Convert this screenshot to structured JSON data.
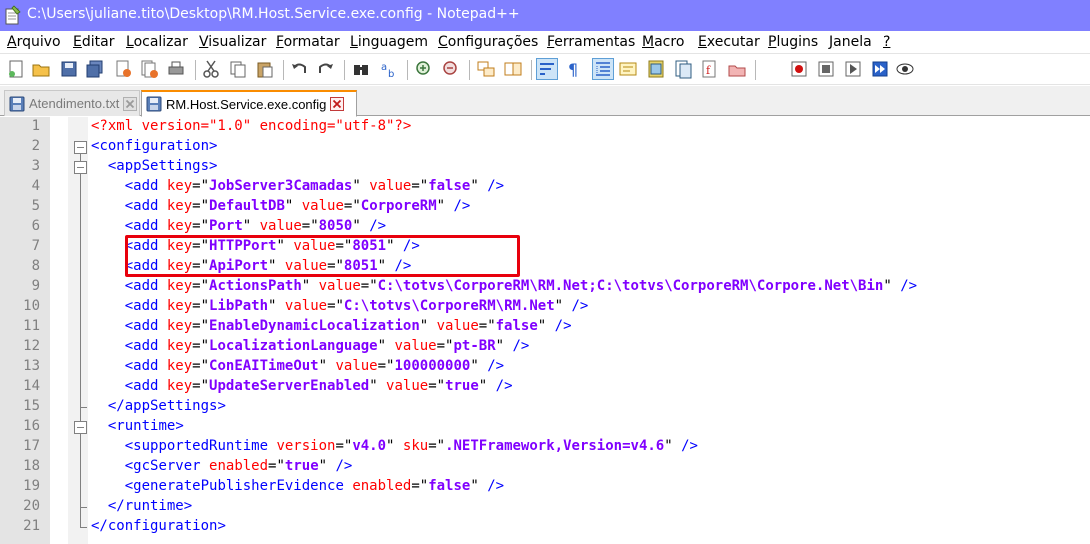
{
  "window": {
    "title": "C:\\Users\\juliane.tito\\Desktop\\RM.Host.Service.exe.config - Notepad++",
    "app_icon": "notepad-plus-plus-icon"
  },
  "menu": [
    {
      "label": "Arquivo",
      "key": "A",
      "rest": "rquivo"
    },
    {
      "label": "Editar",
      "key": "E",
      "rest": "ditar"
    },
    {
      "label": "Localizar",
      "key": "L",
      "rest": "ocalizar"
    },
    {
      "label": "Visualizar",
      "key": "V",
      "rest": "isualizar"
    },
    {
      "label": "Formatar",
      "key": "F",
      "rest": "ormatar"
    },
    {
      "label": "Linguagem",
      "key": "L",
      "rest": "inguagem"
    },
    {
      "label": "Configurações",
      "key": "C",
      "rest": "onfigurações"
    },
    {
      "label": "Ferramentas",
      "key": "F",
      "rest": "erramentas"
    },
    {
      "label": "Macro",
      "key": "M",
      "rest": "acro"
    },
    {
      "label": "Executar",
      "key": "E",
      "rest": "xecutar"
    },
    {
      "label": "Plugins",
      "key": "P",
      "rest": "lugins"
    },
    {
      "label": "Janela",
      "key": "J",
      "rest": "anela"
    },
    {
      "label": "?",
      "key": "?",
      "rest": ""
    }
  ],
  "toolbar_icons": [
    "new-file-icon",
    "open-file-icon",
    "save-icon",
    "save-all-icon",
    "close-icon",
    "close-all-icon",
    "print-icon",
    "cut-icon",
    "copy-icon",
    "paste-icon",
    "undo-icon",
    "redo-icon",
    "find-icon",
    "replace-icon",
    "zoom-in-icon",
    "zoom-out-icon",
    "sync-vertical-icon",
    "sync-horizontal-icon",
    "word-wrap-icon",
    "show-all-chars-icon",
    "indent-guide-icon",
    "language-icon",
    "doc-map-icon",
    "function-list-icon",
    "folder-workspace-icon",
    "monitor-icon",
    "record-macro-icon",
    "stop-record-icon",
    "playback-icon",
    "run-macro-multiple-icon",
    "save-macro-icon"
  ],
  "tabs": [
    {
      "label": "Atendimento.txt",
      "active": false
    },
    {
      "label": "RM.Host.Service.exe.config",
      "active": true
    }
  ],
  "editor": {
    "lines": [
      {
        "n": "1",
        "indent": "",
        "kind": "pi",
        "text": "<?xml version=\"1.0\" encoding=\"utf-8\"?>"
      },
      {
        "n": "2",
        "indent": "",
        "kind": "open",
        "tag": "configuration"
      },
      {
        "n": "3",
        "indent": "  ",
        "kind": "open",
        "tag": "appSettings"
      },
      {
        "n": "4",
        "indent": "    ",
        "kind": "add",
        "key": "JobServer3Camadas",
        "value": "false"
      },
      {
        "n": "5",
        "indent": "    ",
        "kind": "add",
        "key": "DefaultDB",
        "value": "CorporeRM"
      },
      {
        "n": "6",
        "indent": "    ",
        "kind": "add",
        "key": "Port",
        "value": "8050"
      },
      {
        "n": "7",
        "indent": "    ",
        "kind": "add",
        "key": "HTTPPort",
        "value": "8051"
      },
      {
        "n": "8",
        "indent": "    ",
        "kind": "add",
        "key": "ApiPort",
        "value": "8051"
      },
      {
        "n": "9",
        "indent": "    ",
        "kind": "add",
        "key": "ActionsPath",
        "value": "C:\\totvs\\CorporeRM\\RM.Net;C:\\totvs\\CorporeRM\\Corpore.Net\\Bin"
      },
      {
        "n": "10",
        "indent": "    ",
        "kind": "add",
        "key": "LibPath",
        "value": "C:\\totvs\\CorporeRM\\RM.Net"
      },
      {
        "n": "11",
        "indent": "    ",
        "kind": "add",
        "key": "EnableDynamicLocalization",
        "value": "false"
      },
      {
        "n": "12",
        "indent": "    ",
        "kind": "add",
        "key": "LocalizationLanguage",
        "value": "pt-BR"
      },
      {
        "n": "13",
        "indent": "    ",
        "kind": "add",
        "key": "ConEAITimeOut",
        "value": "100000000"
      },
      {
        "n": "14",
        "indent": "    ",
        "kind": "add",
        "key": "UpdateServerEnabled",
        "value": "true"
      },
      {
        "n": "15",
        "indent": "  ",
        "kind": "close",
        "tag": "appSettings"
      },
      {
        "n": "16",
        "indent": "  ",
        "kind": "open",
        "tag": "runtime"
      },
      {
        "n": "17",
        "indent": "    ",
        "kind": "elem",
        "tag": "supportedRuntime",
        "attrs": [
          [
            "version",
            "v4.0"
          ],
          [
            "sku",
            ".NETFramework,Version=v4.6"
          ]
        ]
      },
      {
        "n": "18",
        "indent": "    ",
        "kind": "elem",
        "tag": "gcServer",
        "attrs": [
          [
            "enabled",
            "true"
          ]
        ]
      },
      {
        "n": "19",
        "indent": "    ",
        "kind": "elem",
        "tag": "generatePublisherEvidence",
        "attrs": [
          [
            "enabled",
            "false"
          ]
        ]
      },
      {
        "n": "20",
        "indent": "  ",
        "kind": "close",
        "tag": "runtime"
      },
      {
        "n": "21",
        "indent": "",
        "kind": "close",
        "tag": "configuration"
      }
    ],
    "highlighted_lines": [
      "7",
      "8"
    ]
  },
  "colors": {
    "titlebar": "#8080ff",
    "tag": "#0000ff",
    "attr": "#ff0000",
    "value": "#8000ff",
    "highlight_border": "#e8000c",
    "active_tab_accent": "#fa8c00"
  }
}
